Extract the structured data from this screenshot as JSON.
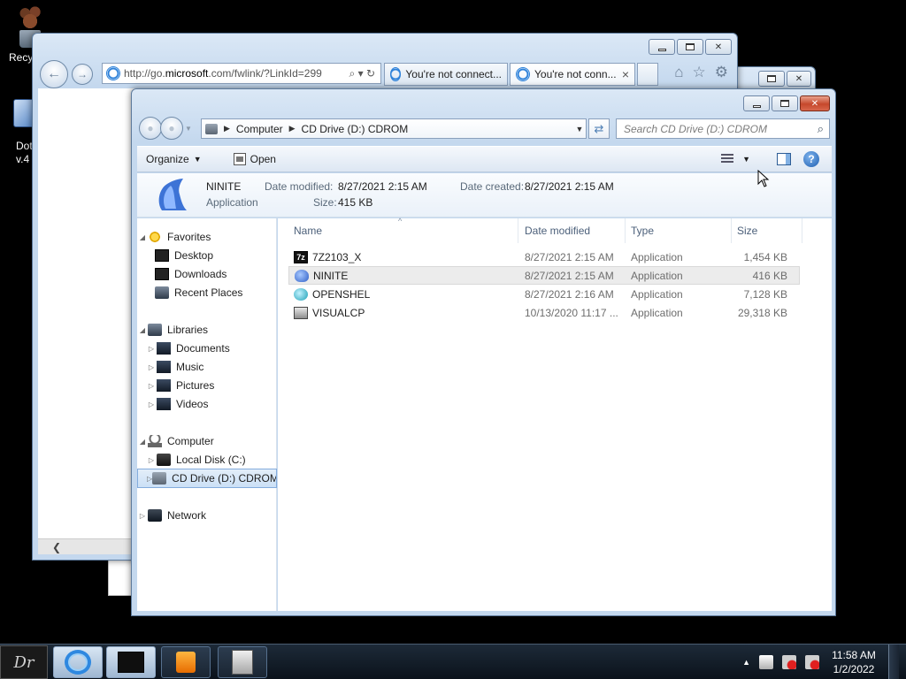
{
  "desktop": {
    "recycle_label": "Recy",
    "dot_label_1": "Dot",
    "dot_label_2": "v.4"
  },
  "ie": {
    "address": "http://go.",
    "address_host": "microsoft",
    "address_rest": ".com/fwlink/?LinkId=299",
    "address_tools": "⌕ ▾ ↻",
    "tabs": [
      "You're not connect...",
      "You're not conn..."
    ],
    "tab_close": "×",
    "tools": [
      "⌂",
      "☆",
      "⚙"
    ],
    "scroll_left": "❮"
  },
  "explorer": {
    "breadcrumb": [
      "Computer",
      "CD Drive (D:) CDROM"
    ],
    "search_placeholder": "Search CD Drive (D:) CDROM",
    "toolbar": {
      "organize": "Organize",
      "open": "Open"
    },
    "details": {
      "name": "NINITE",
      "type": "Application",
      "date_modified_label": "Date modified:",
      "date_modified": "8/27/2021 2:15 AM",
      "date_created_label": "Date created:",
      "date_created": "8/27/2021 2:15 AM",
      "size_label": "Size:",
      "size": "415 KB"
    },
    "nav": {
      "favorites": "Favorites",
      "desktop": "Desktop",
      "downloads": "Downloads",
      "recent": "Recent Places",
      "libraries": "Libraries",
      "documents": "Documents",
      "music": "Music",
      "pictures": "Pictures",
      "videos": "Videos",
      "computer": "Computer",
      "local_disk": "Local Disk (C:)",
      "cd_drive": "CD Drive (D:) CDROM",
      "network": "Network"
    },
    "columns": {
      "name": "Name",
      "date_modified": "Date modified",
      "type": "Type",
      "size": "Size"
    },
    "files": [
      {
        "name": "7Z2103_X",
        "date": "8/27/2021 2:15 AM",
        "type": "Application",
        "size": "1,454 KB"
      },
      {
        "name": "NINITE",
        "date": "8/27/2021 2:15 AM",
        "type": "Application",
        "size": "416 KB"
      },
      {
        "name": "OPENSHEL",
        "date": "8/27/2021 2:16 AM",
        "type": "Application",
        "size": "7,128 KB"
      },
      {
        "name": "VISUALCP",
        "date": "10/13/2020 11:17 ...",
        "type": "Application",
        "size": "29,318 KB"
      }
    ]
  },
  "taskbar": {
    "start_label": "Dr",
    "time": "11:58 AM",
    "date": "1/2/2022"
  }
}
